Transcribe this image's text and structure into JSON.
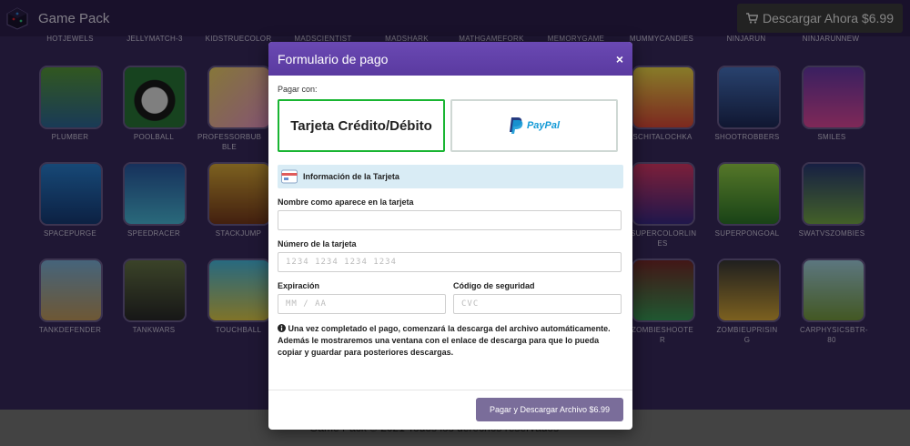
{
  "app": {
    "title": "Game Pack",
    "buy_button": "Descargar Ahora $6.99",
    "footer_text": "Game Pack © 2021 Todos los derechos reservados"
  },
  "top_labels": [
    "HOTJEWELS",
    "JELLYMATCH-3",
    "KIDSTRUECOLOR",
    "MADSCIENTIST",
    "MADSHARK",
    "MATHGAMEFORK",
    "MEMORYGAME",
    "MUMMYCANDIES",
    "NINJARUN",
    "NINJARUNNEW"
  ],
  "tiles_left": [
    [
      "PLUMBER",
      "POOLBALL",
      "PROFESSORBUB BLE"
    ],
    [
      "SPACEPURGE",
      "SPEEDRACER",
      "STACKJUMP"
    ],
    [
      "TANKDEFENDER",
      "TANKWARS",
      "TOUCHBALL"
    ]
  ],
  "tiles_right": [
    [
      "SCHITALOCHKA",
      "SHOOTROBBERS",
      "SMILES"
    ],
    [
      "SUPERCOLORLIN ES",
      "SUPERPONGOAL",
      "SWATVSZOMBIES"
    ],
    [
      "ZOMBIESHOOTE R",
      "ZOMBIEUPRISIN G",
      "CARPHYSICSBTR- 80"
    ]
  ],
  "modal": {
    "title": "Formulario de pago",
    "close": "×",
    "pay_with": "Pagar con:",
    "method_card": "Tarjeta Crédito/Débito",
    "method_paypal": "PayPal",
    "section_title": "Información de la Tarjeta",
    "name_label": "Nombre como aparece en la tarjeta",
    "name_value": "",
    "number_label": "Número de la tarjeta",
    "number_placeholder": "1234 1234 1234 1234",
    "expiry_label": "Expiración",
    "expiry_placeholder": "MM / AA",
    "cvc_label": "Código de seguridad",
    "cvc_placeholder": "CVC",
    "notice": "Una vez completado el pago, comenzará la descarga del archivo automáticamente. Además le mostraremos una ventana con el enlace de descarga para que lo pueda copiar y guardar para posteriores descargas.",
    "submit": "Pagar y Descargar Archivo $6.99"
  },
  "colors": {
    "header_purple": "#5a3aa0",
    "active_border": "#19b532",
    "paypal_blue": "#139ad6",
    "submit_bg": "#7a6d9a"
  }
}
